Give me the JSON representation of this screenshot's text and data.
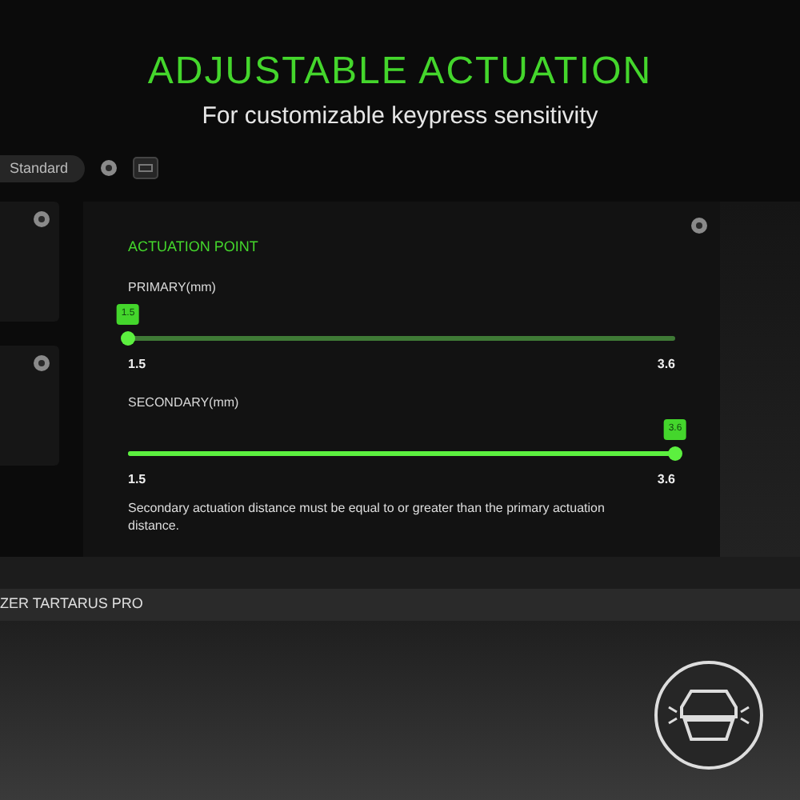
{
  "headline": {
    "title": "ADJUSTABLE ACTUATION",
    "subtitle": "For customizable keypress sensitivity"
  },
  "toolbar": {
    "mode": "Standard"
  },
  "panel": {
    "title": "ACTUATION POINT",
    "sliders": [
      {
        "label": "PRIMARY(mm)",
        "value": "1.5",
        "min": "1.5",
        "max": "3.6",
        "level": 0
      },
      {
        "label": "SECONDARY(mm)",
        "value": "3.6",
        "min": "1.5",
        "max": "3.6",
        "level": 1
      }
    ],
    "note": "Secondary actuation distance must be equal to or greater than the primary actuation distance."
  },
  "device_bar": {
    "name": "ZER TARTARUS PRO"
  }
}
